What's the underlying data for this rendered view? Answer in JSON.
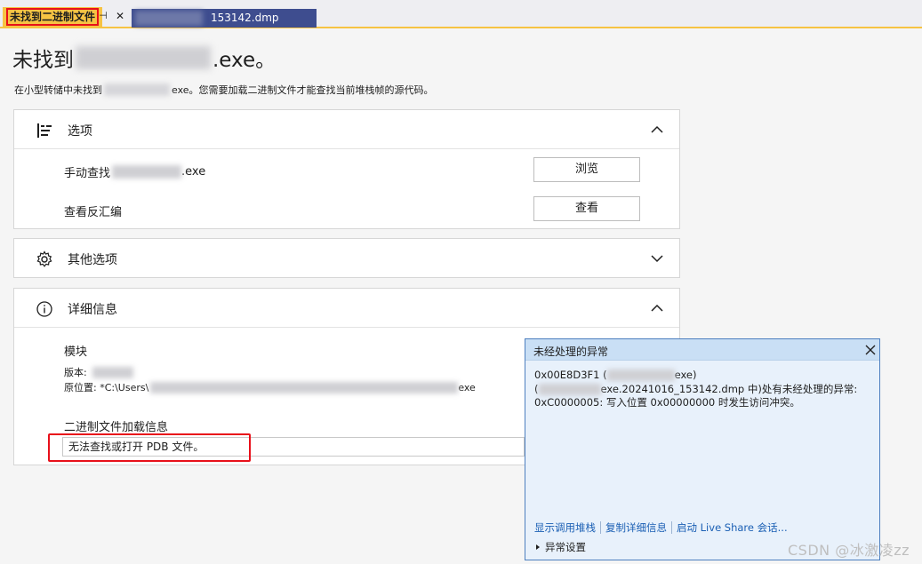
{
  "tabs": {
    "active_label": "未找到二进制文件",
    "pin_glyph": "⊣",
    "close_glyph": "✕",
    "inactive_label": "153142.dmp"
  },
  "header": {
    "title_prefix": "未找到",
    "title_suffix": ".exe。",
    "subtitle_prefix": "在小型转储中未找到",
    "subtitle_suffix": "exe。您需要加载二进制文件才能查找当前堆栈帧的源代码。"
  },
  "options": {
    "title": "选项",
    "manual_find_prefix": "手动查找",
    "manual_find_suffix": ".exe",
    "browse_button": "浏览",
    "view_disasm_label": "查看反汇编",
    "view_button": "查看"
  },
  "other_options": {
    "title": "其他选项"
  },
  "details": {
    "title": "详细信息",
    "module_heading": "模块",
    "version_label": "版本:",
    "location_label": "原位置: *C:\\Users\\",
    "location_suffix": "exe",
    "binary_load_heading": "二进制文件加载信息",
    "pdb_message": "无法查找或打开 PDB 文件。"
  },
  "popup": {
    "title": "未经处理的异常",
    "line1_prefix": "0x00E8D3F1 (",
    "line1_suffix": "exe)",
    "line2_prefix": "(",
    "line2_suffix": "exe.20241016_153142.dmp 中)处有未经处理的异常:",
    "line3": "0xC0000005: 写入位置 0x00000000 时发生访问冲突。",
    "link_callstack": "显示调用堆栈",
    "link_copy": "复制详细信息",
    "link_liveshare": "启动 Live Share 会话...",
    "settings_label": "异常设置"
  },
  "watermark": "CSDN @冰激凌zz"
}
